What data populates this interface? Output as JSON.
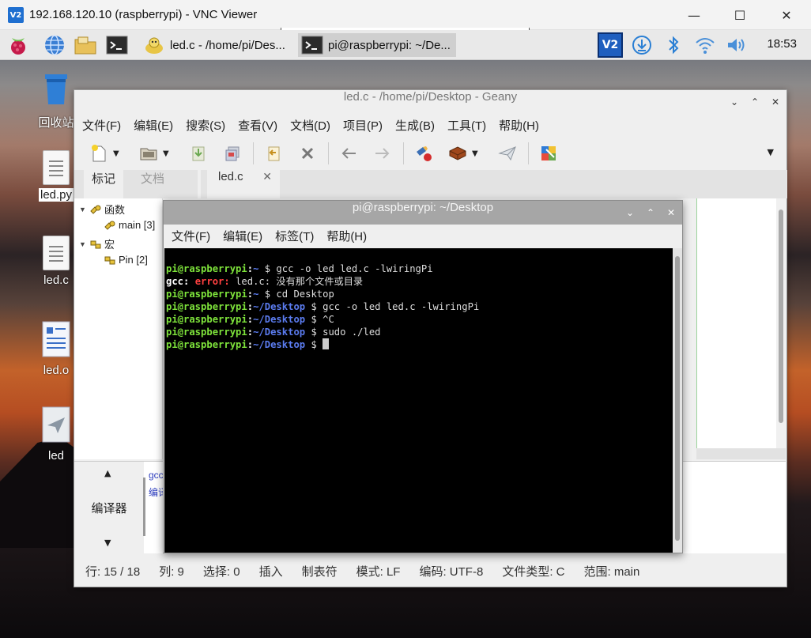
{
  "vnc": {
    "logo": "V2",
    "title": "192.168.120.10 (raspberrypi) - VNC Viewer",
    "minimize": "—",
    "maximize": "☐",
    "close": "✕"
  },
  "taskbar": {
    "tasks": [
      {
        "label": "led.c - /home/pi/Des...",
        "icon": "geany-icon",
        "active": false
      },
      {
        "label": "pi@raspberrypi: ~/De...",
        "icon": "terminal-icon",
        "active": true
      }
    ],
    "clock": "18:53"
  },
  "desktop_icons": [
    {
      "label": "回收站",
      "icon": "trash-icon"
    },
    {
      "label": "led.py",
      "icon": "document-icon"
    },
    {
      "label": "led.c",
      "icon": "document-icon"
    },
    {
      "label": "led.o",
      "icon": "object-file-icon"
    },
    {
      "label": "led",
      "icon": "executable-icon"
    }
  ],
  "geany": {
    "title": "led.c - /home/pi/Desktop - Geany",
    "menu": [
      "文件(F)",
      "编辑(E)",
      "搜索(S)",
      "查看(V)",
      "文档(D)",
      "项目(P)",
      "生成(B)",
      "工具(T)",
      "帮助(H)"
    ],
    "side_tabs": [
      "标记",
      "文档"
    ],
    "symbols": {
      "functions": "函数",
      "main": "main [3]",
      "macros": "宏",
      "pin": "Pin [2]"
    },
    "doc_tab": "led.c",
    "doc_tab_close": "✕",
    "msg_tab": "编译器",
    "msg_lines": [
      "gcc",
      "编译"
    ],
    "status": {
      "line": "行: 15 / 18",
      "col": "列: 9",
      "sel": "选择: 0",
      "mode": "插入",
      "indent": "制表符",
      "eol": "模式: LF",
      "encoding": "编码: UTF-8",
      "filetype": "文件类型: C",
      "scope": "范围: main"
    }
  },
  "terminal": {
    "title": "pi@raspberrypi: ~/Desktop",
    "menu": [
      "文件(F)",
      "编辑(E)",
      "标签(T)",
      "帮助(H)"
    ],
    "lines": [
      {
        "user": "pi@raspberrypi",
        "sep": ":",
        "path": "~",
        "cmd": " $ gcc -o led led.c -lwiringPi"
      },
      {
        "gcc": "gcc:",
        "error": "error:",
        "rest": " led.c: 没有那个文件或目录"
      },
      {
        "user": "pi@raspberrypi",
        "sep": ":",
        "path": "~",
        "cmd": " $ cd Desktop"
      },
      {
        "user": "pi@raspberrypi",
        "sep": ":",
        "path": "~/Desktop",
        "cmd": " $ gcc -o led led.c -lwiringPi"
      },
      {
        "user": "pi@raspberrypi",
        "sep": ":",
        "path": "~/Desktop",
        "cmd": " $ ^C"
      },
      {
        "user": "pi@raspberrypi",
        "sep": ":",
        "path": "~/Desktop",
        "cmd": " $ sudo ./led"
      },
      {
        "user": "pi@raspberrypi",
        "sep": ":",
        "path": "~/Desktop",
        "cmd": " $ "
      }
    ]
  }
}
